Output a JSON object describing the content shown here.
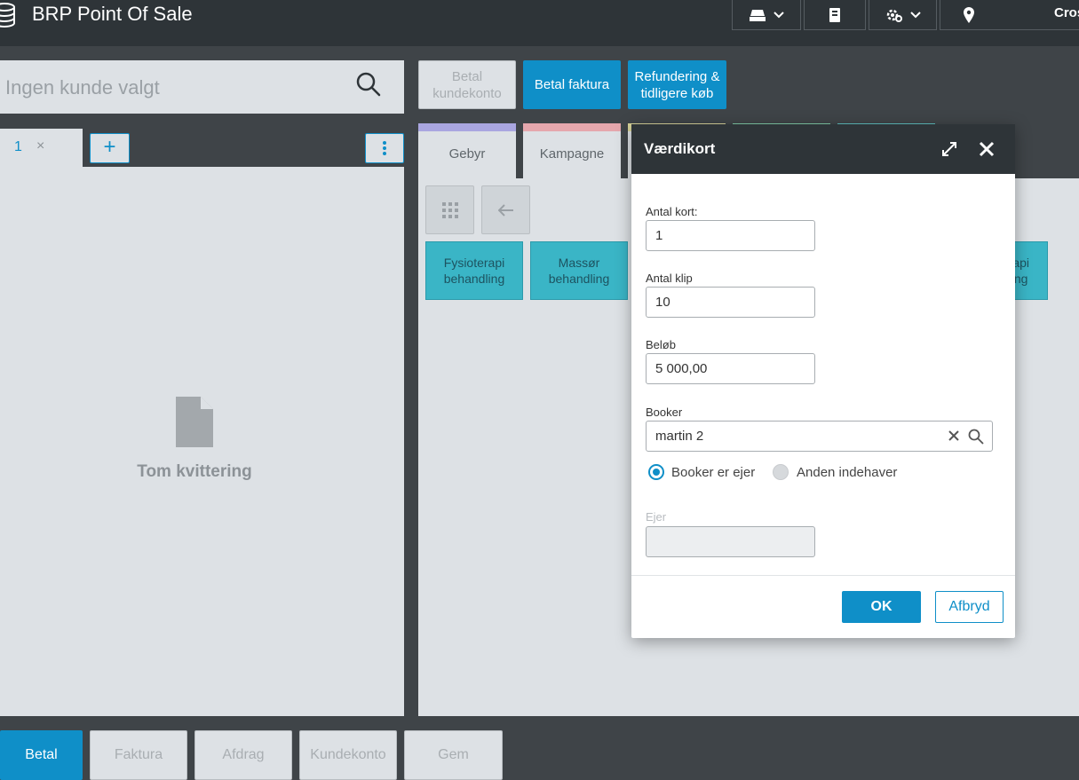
{
  "header": {
    "title": "BRP Point Of Sale",
    "user": "Cros"
  },
  "customer_search": {
    "placeholder": "Ingen kunde valgt"
  },
  "receipt_tab": {
    "number": "1",
    "close": "×",
    "add": "+"
  },
  "receipt": {
    "empty_label": "Tom kvittering"
  },
  "actions": {
    "pay_account": "Betal kundekonto",
    "pay_invoice": "Betal faktura",
    "refund": "Refundering & tidligere køb"
  },
  "categories": [
    {
      "label": "Gebyr",
      "color": "#a9a6e0"
    },
    {
      "label": "Kampagne",
      "color": "#e5a7ad"
    }
  ],
  "products": [
    {
      "label": "Fysioterapi behandling"
    },
    {
      "label": "Massør behandling"
    },
    {
      "label": "api\nng"
    }
  ],
  "bottom": {
    "pay": "Betal",
    "invoice": "Faktura",
    "installment": "Afdrag",
    "account": "Kundekonto",
    "save": "Gem"
  },
  "dialog": {
    "title": "Værdikort",
    "card_count_label": "Antal kort:",
    "card_count": "1",
    "clips_label": "Antal klip",
    "clips": "10",
    "amount_label": "Beløb",
    "amount": "5 000,00",
    "booker_label": "Booker",
    "booker": "martin 2",
    "radio_owner": "Booker er ejer",
    "radio_other": "Anden indehaver",
    "owner_label": "Ejer",
    "owner": "",
    "ok": "OK",
    "cancel": "Afbryd"
  },
  "colors": {
    "accent": "#0f8fc8",
    "header_bg": "#2e3438",
    "product_bg": "#3ab5c6"
  }
}
